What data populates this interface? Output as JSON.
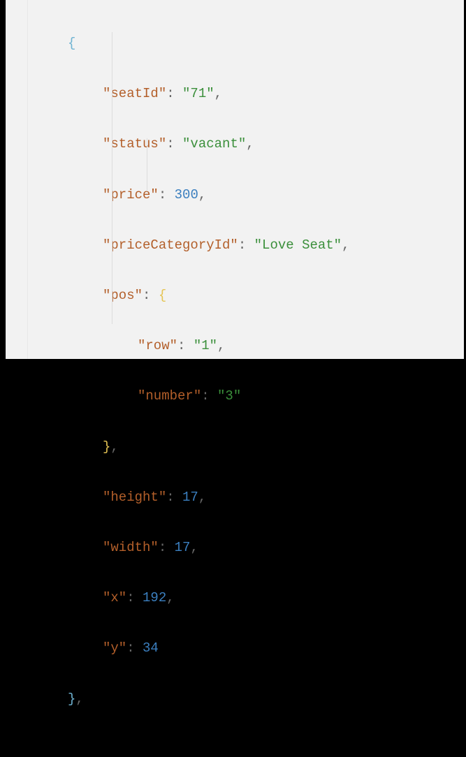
{
  "code": {
    "open_obj": "{",
    "close_obj": "}",
    "open_nested": "{",
    "close_nested": "}",
    "comma": ",",
    "colon": ":",
    "keys": {
      "seatId": "\"seatId\"",
      "status": "\"status\"",
      "price": "\"price\"",
      "priceCategoryId": "\"priceCategoryId\"",
      "pos": "\"pos\"",
      "row": "\"row\"",
      "number": "\"number\"",
      "height": "\"height\"",
      "width": "\"width\"",
      "x": "\"x\"",
      "y": "\"y\""
    },
    "values": {
      "seatId": "\"71\"",
      "status": "\"vacant\"",
      "price": "300",
      "priceCategoryId": "\"Love Seat\"",
      "row": "\"1\"",
      "number": "\"3\"",
      "height": "17",
      "width": "17",
      "x": "192",
      "y": "34"
    }
  }
}
